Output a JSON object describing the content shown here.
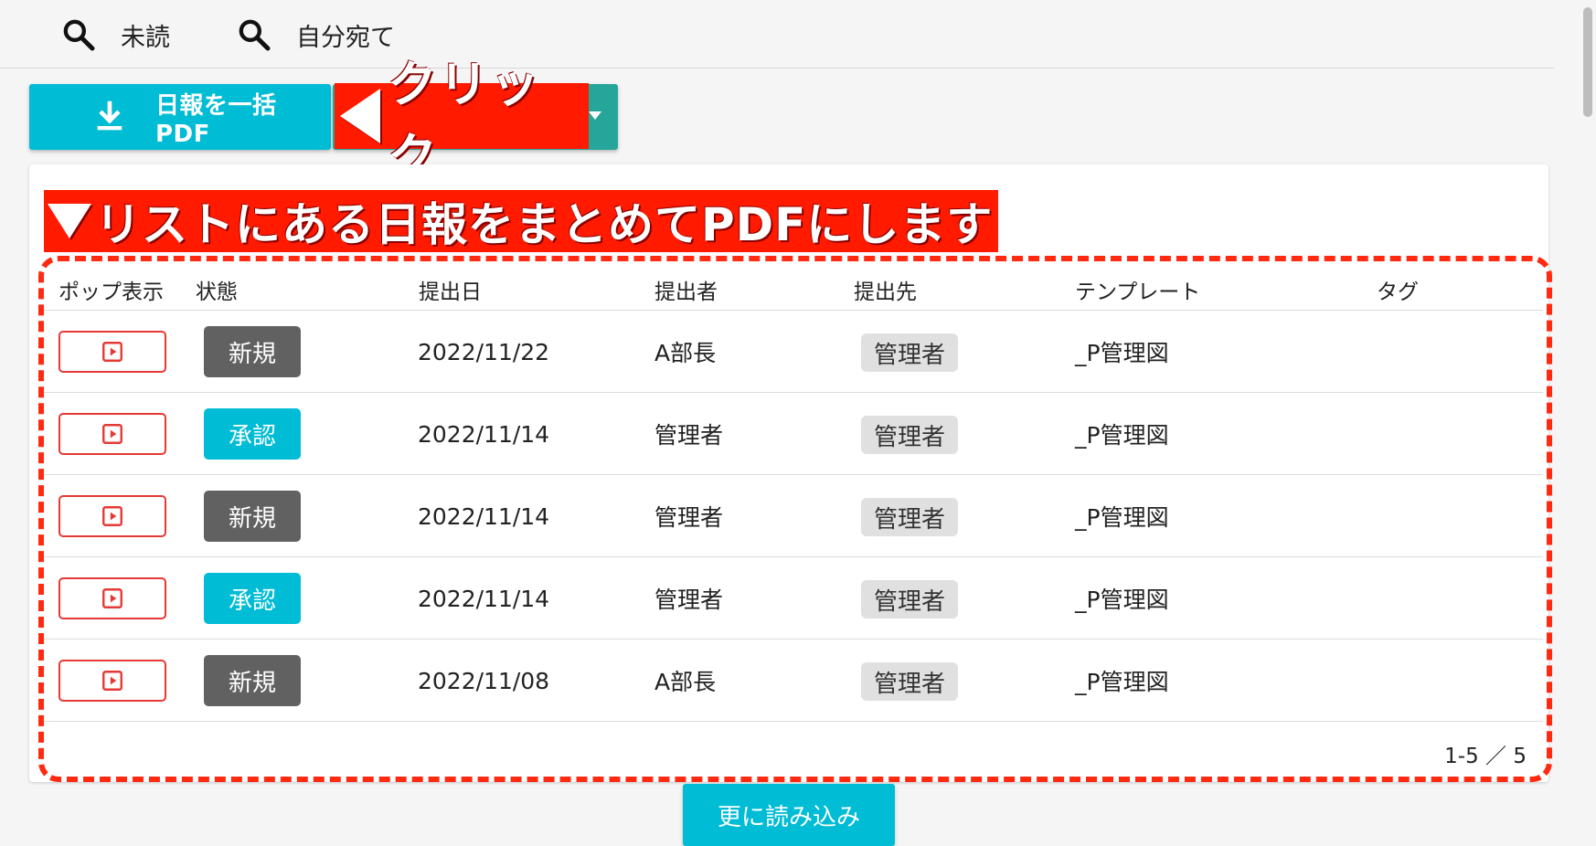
{
  "filters": [
    {
      "label": "未読",
      "icon": "search-icon"
    },
    {
      "label": "自分宛て",
      "icon": "search-icon"
    }
  ],
  "toolbar": {
    "pdf_button_label": "日報を一括PDF",
    "pdf_button_icon": "download-icon"
  },
  "annotations": {
    "click_callout": "クリック",
    "list_callout": "リストにある日報をまとめてPDFにします"
  },
  "table": {
    "headers": [
      "ポップ表示",
      "状態",
      "提出日",
      "提出者",
      "提出先",
      "テンプレート",
      "タグ"
    ],
    "rows": [
      {
        "status": "新規",
        "status_color": "#616161",
        "date": "2022/11/22",
        "submitter": "A部長",
        "recipient": "管理者",
        "template": "_P管理図",
        "tag": ""
      },
      {
        "status": "承認",
        "status_color": "#00bcd4",
        "date": "2022/11/14",
        "submitter": "管理者",
        "recipient": "管理者",
        "template": "_P管理図",
        "tag": ""
      },
      {
        "status": "新規",
        "status_color": "#616161",
        "date": "2022/11/14",
        "submitter": "管理者",
        "recipient": "管理者",
        "template": "_P管理図",
        "tag": ""
      },
      {
        "status": "承認",
        "status_color": "#00bcd4",
        "date": "2022/11/14",
        "submitter": "管理者",
        "recipient": "管理者",
        "template": "_P管理図",
        "tag": ""
      },
      {
        "status": "新規",
        "status_color": "#616161",
        "date": "2022/11/08",
        "submitter": "A部長",
        "recipient": "管理者",
        "template": "_P管理図",
        "tag": ""
      }
    ]
  },
  "pagination": {
    "text": "1-5 ／ 5"
  },
  "load_more_label": "更に読み込み",
  "colors": {
    "accent": "#00bcd4",
    "secondary": "#26a69a",
    "callout": "#ff1a00",
    "popup_border": "#e53935"
  }
}
